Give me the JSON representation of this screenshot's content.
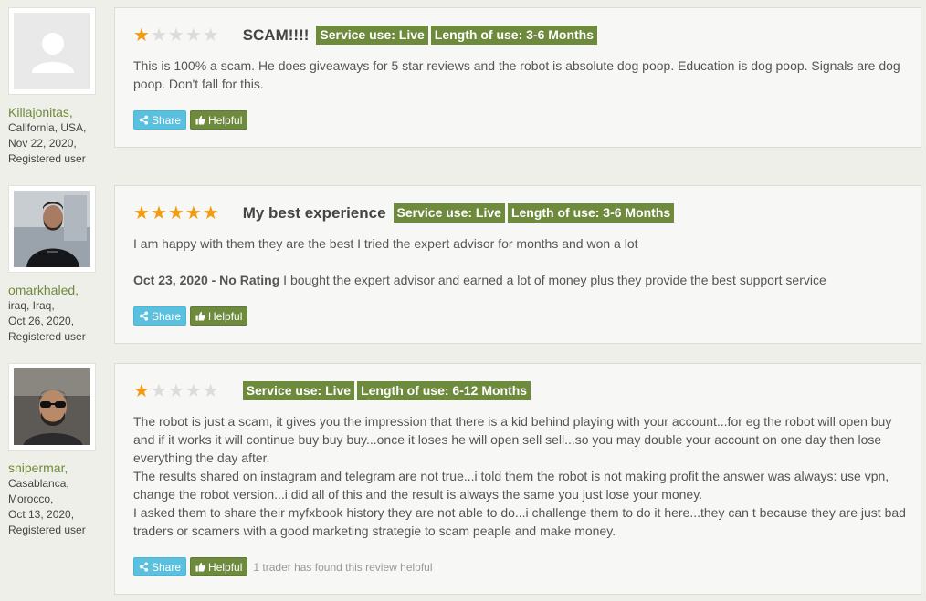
{
  "reviews": [
    {
      "avatar": "default-user-icon",
      "user": {
        "name": "Killajonitas",
        "location": "California, USA,",
        "date": "Nov 22, 2020,",
        "role": "Registered user"
      },
      "rating": 1,
      "title": "SCAM!!!!",
      "badges": [
        "Service use: Live",
        "Length of use: 3-6 Months"
      ],
      "text": "This is 100% a scam. He does giveaways for 5 star reviews and the robot is absolute dog poop. Education is dog poop. Signals are dog poop. Don't fall for this.",
      "share_label": "Share",
      "helpful_label": "Helpful"
    },
    {
      "avatar": "user-photo",
      "user": {
        "name": "omarkhaled",
        "location": "iraq, Iraq,",
        "date": "Oct 26, 2020,",
        "role": "Registered user"
      },
      "rating": 5,
      "title": "My best experience",
      "badges": [
        "Service use: Live",
        "Length of use: 3-6 Months"
      ],
      "text": "I am happy with them they are the best I tried the expert advisor for months and won a lot",
      "update_date": "Oct 23, 2020 - No Rating",
      "update_text": " I bought the expert advisor and earned a lot of money plus they provide the best support service",
      "share_label": "Share",
      "helpful_label": "Helpful"
    },
    {
      "avatar": "user-photo",
      "user": {
        "name": "snipermar",
        "location": "Casablanca, Morocco,",
        "date": "Oct 13, 2020,",
        "role": "Registered user"
      },
      "rating": 1,
      "title": "",
      "badges": [
        "Service use: Live",
        "Length of use: 6-12 Months"
      ],
      "paragraphs": [
        "The robot is just a scam, it gives you the impression that there is a kid behind playing with your account...for eg the robot will open buy and if it works it will continue buy buy buy...once it loses he will open sell sell...so you may double your account on one day then lose everything the day after.",
        "The results shared on instagram and telegram are not true...i told them the robot is not making profit the answer was always: use vpn, change the robot version...i did all of this and the result is always the same you just lose your money.",
        "I asked them to share their myfxbook history they are not able to do...i challenge them to do it here...they can t because they are just bad traders or scamers with a good marketing strategie to scam peaple and make money."
      ],
      "share_label": "Share",
      "helpful_label": "Helpful",
      "helpful_count": "1 trader has found this review helpful"
    }
  ],
  "colors": {
    "accent": "#6e8b3d",
    "share": "#5bc0de",
    "star_on": "#f39c12",
    "star_off": "#dcdcdc"
  }
}
